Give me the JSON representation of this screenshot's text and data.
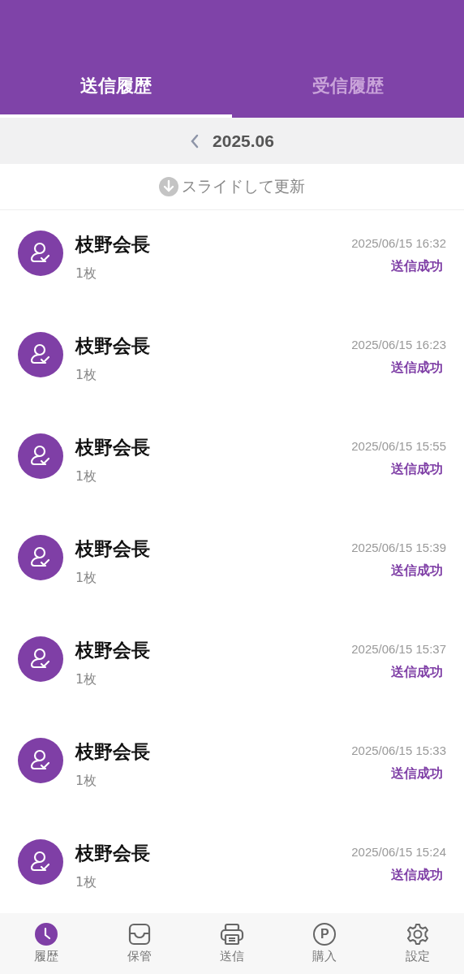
{
  "tabs": [
    {
      "label": "送信履歴",
      "selected": true
    },
    {
      "label": "受信履歴",
      "selected": false
    }
  ],
  "month": "2025.06",
  "refresh_hint": "スライドして更新",
  "records": [
    {
      "name": "枝野会長",
      "count": "1枚",
      "time": "2025/06/15 16:32",
      "status": "送信成功"
    },
    {
      "name": "枝野会長",
      "count": "1枚",
      "time": "2025/06/15 16:23",
      "status": "送信成功"
    },
    {
      "name": "枝野会長",
      "count": "1枚",
      "time": "2025/06/15 15:55",
      "status": "送信成功"
    },
    {
      "name": "枝野会長",
      "count": "1枚",
      "time": "2025/06/15 15:39",
      "status": "送信成功"
    },
    {
      "name": "枝野会長",
      "count": "1枚",
      "time": "2025/06/15 15:37",
      "status": "送信成功"
    },
    {
      "name": "枝野会長",
      "count": "1枚",
      "time": "2025/06/15 15:33",
      "status": "送信成功"
    },
    {
      "name": "枝野会長",
      "count": "1枚",
      "time": "2025/06/15 15:24",
      "status": "送信成功"
    }
  ],
  "bottom_nav": [
    {
      "kind": "history",
      "label": "履歴",
      "selected": true
    },
    {
      "kind": "storage",
      "label": "保管",
      "selected": false
    },
    {
      "kind": "send",
      "label": "送信",
      "selected": false
    },
    {
      "kind": "purchase",
      "label": "購入",
      "selected": false,
      "icon_text": "P"
    },
    {
      "kind": "settings",
      "label": "設定",
      "selected": false
    }
  ]
}
